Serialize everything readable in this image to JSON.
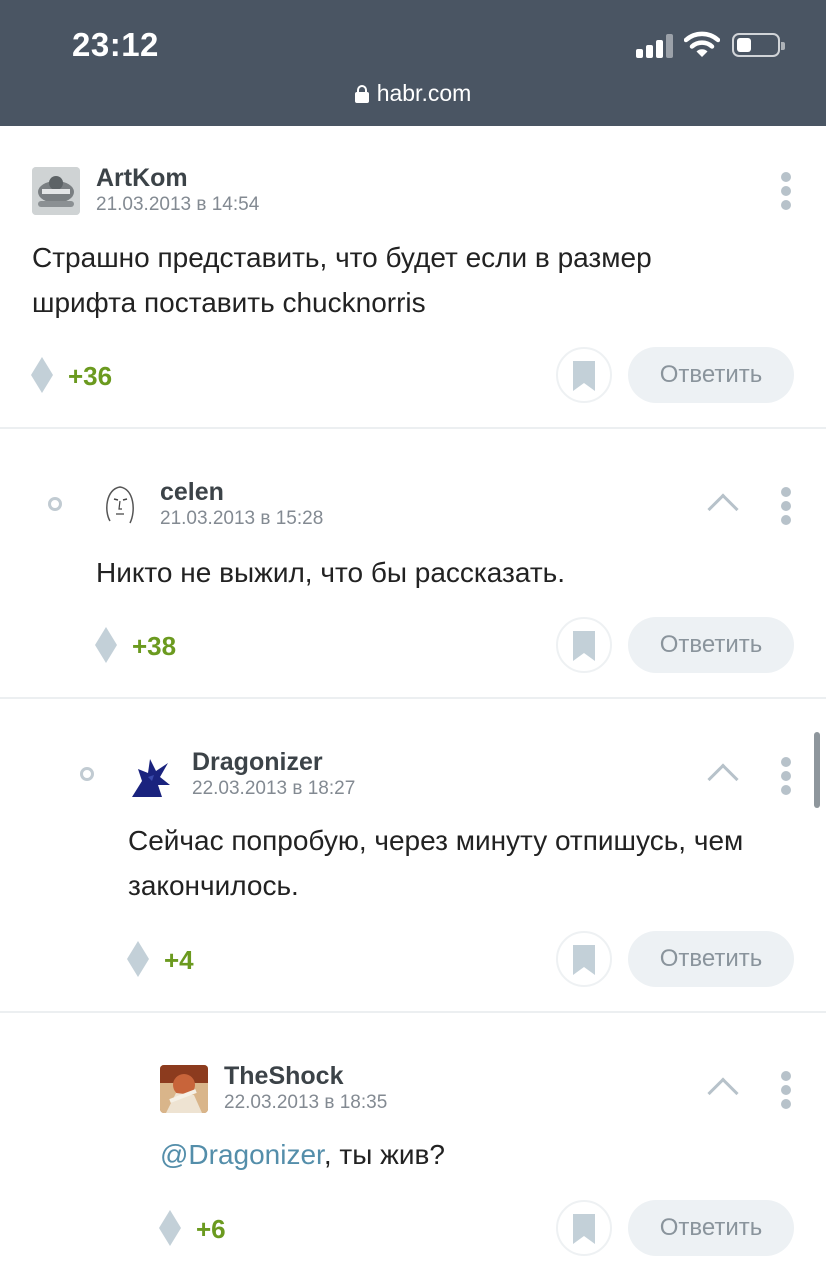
{
  "status_bar": {
    "time": "23:12",
    "url": "habr.com"
  },
  "colors": {
    "status_bg": "#4a5563",
    "score": "#6b9a1f",
    "mention": "#548eaa",
    "reply_bg": "#edf1f4"
  },
  "comments": [
    {
      "username": "ArtKom",
      "date": "21.03.2013 в 14:54",
      "text": "Страшно представить, что будет если в размер шрифта поставить chucknorris",
      "score": "+36",
      "reply_label": "Ответить",
      "avatar_icon": "artkom-avatar",
      "level": 0
    },
    {
      "username": "celen",
      "date": "21.03.2013 в 15:28",
      "text": "Никто не выжил, что бы рассказать.",
      "score": "+38",
      "reply_label": "Ответить",
      "avatar_icon": "celen-avatar",
      "level": 1
    },
    {
      "username": "Dragonizer",
      "date": "22.03.2013 в 18:27",
      "text": "Сейчас попробую, через минуту отпишусь, чем закончилось.",
      "score": "+4",
      "reply_label": "Ответить",
      "avatar_icon": "dragonizer-avatar",
      "level": 2
    },
    {
      "username": "TheShock",
      "date": "22.03.2013 в 18:35",
      "text_mention": "@Dragonizer",
      "text": ", ты жив?",
      "score": "+6",
      "reply_label": "Ответить",
      "avatar_icon": "theshock-avatar",
      "level": 3
    }
  ]
}
